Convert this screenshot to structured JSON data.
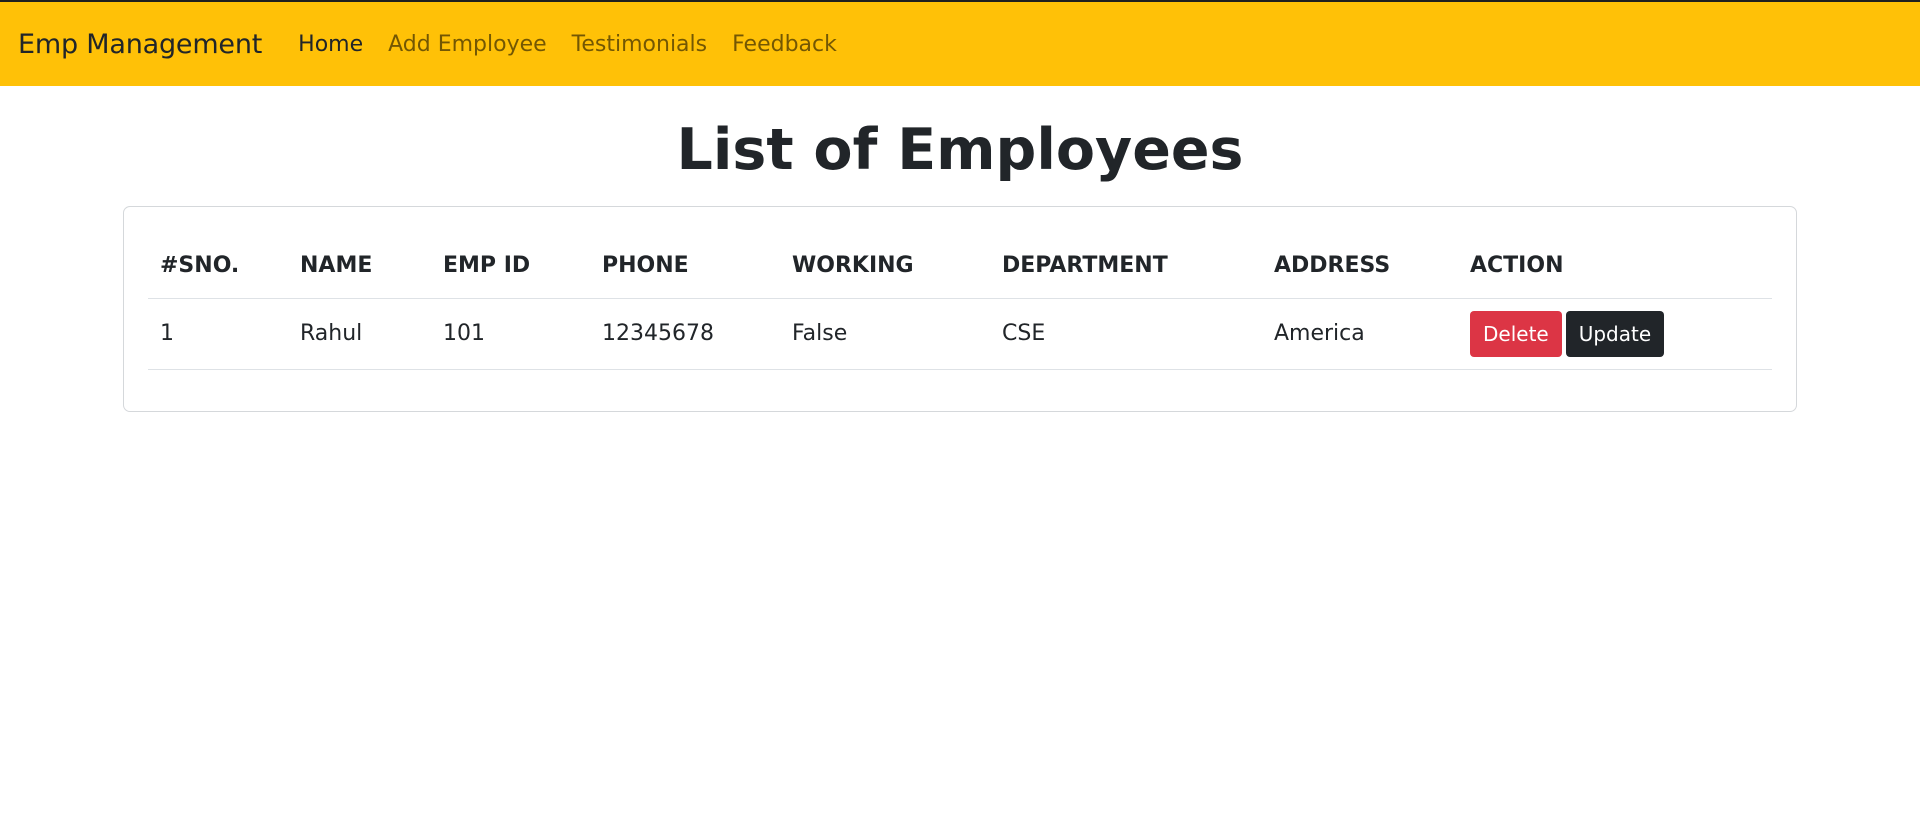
{
  "navbar": {
    "brand": "Emp Management",
    "links": [
      {
        "label": "Home",
        "active": true
      },
      {
        "label": "Add Employee",
        "active": false
      },
      {
        "label": "Testimonials",
        "active": false
      },
      {
        "label": "Feedback",
        "active": false
      }
    ],
    "background": "#ffc107"
  },
  "main": {
    "title": "List of Employees"
  },
  "table": {
    "headers": [
      "#SNO.",
      "NAME",
      "EMP ID",
      "PHONE",
      "WORKING",
      "DEPARTMENT",
      "ADDRESS",
      "ACTION"
    ],
    "rows": [
      {
        "sno": "1",
        "name": "Rahul",
        "emp_id": "101",
        "phone": "12345678",
        "working": "False",
        "department": "CSE",
        "address": "America",
        "delete_label": "Delete",
        "update_label": "Update"
      }
    ]
  },
  "colors": {
    "danger": "#dc3545",
    "dark": "#212529"
  }
}
